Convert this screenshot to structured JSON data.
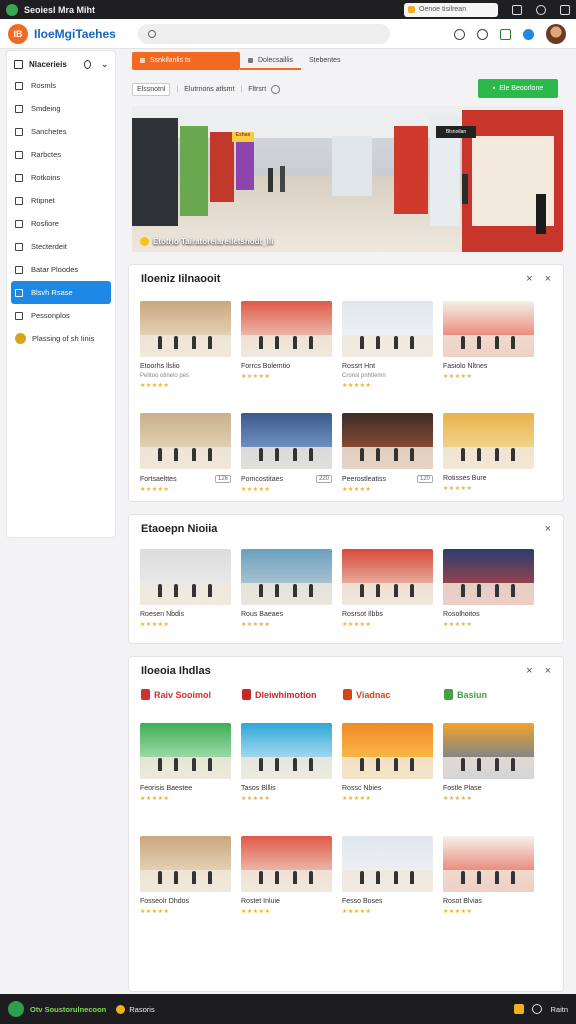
{
  "os_bar": {
    "title": "Seoiesl Mra Miht",
    "notification": "Oenoe tisilrean"
  },
  "app": {
    "logo_text": "IB",
    "name": "IloeMgiTaehes"
  },
  "search": {
    "placeholder": ""
  },
  "sidebar": {
    "header": "Nlacerieis",
    "items": [
      {
        "label": "Rosmls",
        "icon": "home-icon"
      },
      {
        "label": "Smdeing",
        "icon": "page-icon"
      },
      {
        "label": "Sanchetes",
        "icon": "list-icon"
      },
      {
        "label": "Rarbctes",
        "icon": "doc-icon"
      },
      {
        "label": "Rotkoins",
        "icon": "doc-icon"
      },
      {
        "label": "Rtipnet",
        "icon": "doc-icon"
      },
      {
        "label": "Rosfiore",
        "icon": "list-icon"
      },
      {
        "label": "Stecterdeit",
        "icon": "tag-icon"
      },
      {
        "label": "Batar Ploodes",
        "icon": "store-icon"
      },
      {
        "label": "Blsvh Rsase",
        "icon": "store-icon",
        "active": true
      },
      {
        "label": "Pessonplos",
        "icon": "gear-icon"
      },
      {
        "label": "Plassing of sh Iinis",
        "icon": "coin-icon"
      }
    ]
  },
  "tabs": [
    {
      "label": "Ssnkilanlis ts"
    },
    {
      "label": "Dolecsaillis"
    },
    {
      "label": "Stebentes"
    }
  ],
  "toolbar": {
    "filter1": "Elssnotnl",
    "filter2": "Elutrnons atlsmt",
    "filter3": "Fltrsrt",
    "cta": "Ele Beoorlone"
  },
  "hero": {
    "caption": "Etotrlo Tairatoreiarelletshodt_lli",
    "sign1": "Eshae",
    "sign2": "Blsnoilan"
  },
  "panel1": {
    "title": "Iloeniz Iilnaooit",
    "cards": [
      {
        "name": "Etoorhs llslio",
        "meta": "Pelitoo otinelo pes",
        "stars": "★★★★★"
      },
      {
        "name": "Forrcs Bolemtio",
        "meta": "",
        "stars": "★★★★★"
      },
      {
        "name": "Rossrt Hnt",
        "meta": "Cronsl pnhtlemn",
        "stars": "★★★★★"
      },
      {
        "name": "Fasiolo Nltnes",
        "meta": "",
        "stars": "★★★★★"
      },
      {
        "name": "Fortsaelttes",
        "meta": "",
        "stars": "★★★★★",
        "dim": "126"
      },
      {
        "name": "Pomcostitaes",
        "meta": "",
        "stars": "★★★★★",
        "dim": "220"
      },
      {
        "name": "Peerostleatiss",
        "meta": "",
        "stars": "★★★★★",
        "dim": "120"
      },
      {
        "name": "Rotisses Bure",
        "meta": "",
        "stars": "★★★★★"
      }
    ]
  },
  "panel2": {
    "title": "Etaoepn Nioiia",
    "cards": [
      {
        "name": "Roesen Nbdis",
        "meta": "",
        "stars": "★★★★★"
      },
      {
        "name": "Rous Baeaes",
        "meta": "",
        "stars": "★★★★★"
      },
      {
        "name": "Rosrsot Ilbbs",
        "meta": "",
        "stars": "★★★★★"
      },
      {
        "name": "Rosolhoitos",
        "meta": "",
        "stars": "★★★★★"
      }
    ]
  },
  "panel3": {
    "title": "Iloeoia Ihdlas",
    "brands": [
      {
        "label": "Raiv Sooimol",
        "color": "#d32f2f"
      },
      {
        "label": "Dleiwhimotion",
        "color": "#c62828"
      },
      {
        "label": "Viadnac",
        "color": "#d84315"
      },
      {
        "label": "Basiun",
        "color": "#43a047"
      }
    ],
    "cards": [
      {
        "name": "Feorisis Baestee",
        "meta": "",
        "stars": "★★★★★"
      },
      {
        "name": "Tasos Blllis",
        "meta": "",
        "stars": "★★★★★"
      },
      {
        "name": "Rossc Nbies",
        "meta": "",
        "stars": "★★★★★"
      },
      {
        "name": "Fostle Plase",
        "meta": "",
        "stars": "★★★★★"
      },
      {
        "name": "Fosseolr Dhdos",
        "meta": "",
        "stars": "★★★★★"
      },
      {
        "name": "Rostet Inluie",
        "meta": "",
        "stars": "★★★★★"
      },
      {
        "name": "Fesso Boses",
        "meta": "",
        "stars": "★★★★★"
      },
      {
        "name": "Rosot Blvias",
        "meta": "",
        "stars": "★★★★★"
      }
    ]
  },
  "taskbar": {
    "app": "Otv Soustorulnecoon",
    "item": "Rasoris",
    "right": "Raitn"
  }
}
